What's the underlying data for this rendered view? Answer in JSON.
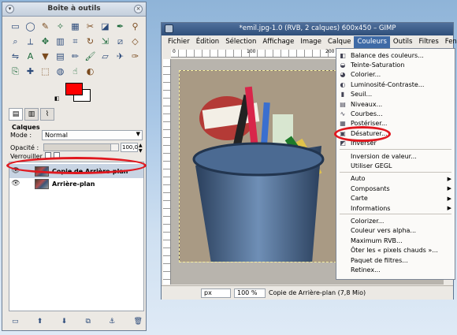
{
  "toolbox": {
    "title": "Boîte à outils",
    "tool_icons": [
      "rect-select",
      "ellipse-select",
      "free-select",
      "fuzzy-select",
      "color-select",
      "scissors-select",
      "foreground-select",
      "paths",
      "color-picker",
      "zoom",
      "measure",
      "move",
      "align",
      "crop",
      "rotate",
      "scale",
      "shear",
      "perspective",
      "flip",
      "text",
      "bucket-fill",
      "gradient",
      "pencil",
      "paintbrush",
      "eraser",
      "airbrush",
      "ink",
      "clone",
      "heal",
      "perspective-clone",
      "blur",
      "smudge",
      "dodge-burn"
    ],
    "colors": {
      "foreground": "#ff0000",
      "background": "#ffffff"
    },
    "layers_panel": {
      "title": "Calques",
      "mode_label": "Mode :",
      "mode_value": "Normal",
      "opacity_label": "Opacité :",
      "opacity_value": "100,0",
      "lock_label": "Verrouiller :",
      "layers": [
        {
          "name": "Copie de Arrière-plan",
          "visible": true,
          "selected": true
        },
        {
          "name": "Arrière-plan",
          "visible": true,
          "selected": false
        }
      ]
    }
  },
  "image_window": {
    "title": "*emil.jpg-1.0 (RVB, 2 calques) 600x450 – GIMP",
    "menus": [
      "Fichier",
      "Édition",
      "Sélection",
      "Affichage",
      "Image",
      "Calque",
      "Couleurs",
      "Outils",
      "Filtres",
      "Fenêtre"
    ],
    "open_menu": "Couleurs",
    "ruler_labels": [
      "0",
      "100",
      "200"
    ],
    "status": {
      "unit": "px",
      "zoom": "100 %",
      "text": "Copie de Arrière-plan (7,8 Mio)"
    }
  },
  "couleurs_menu": {
    "items": [
      {
        "label": "Balance des couleurs...",
        "icon": "color-balance-icon"
      },
      {
        "label": "Teinte-Saturation",
        "icon": "hue-saturation-icon"
      },
      {
        "label": "Colorier...",
        "icon": "colorize-icon"
      },
      {
        "label": "Luminosité-Contraste...",
        "icon": "brightness-contrast-icon"
      },
      {
        "label": "Seuil...",
        "icon": "threshold-icon"
      },
      {
        "label": "Niveaux...",
        "icon": "levels-icon"
      },
      {
        "label": "Courbes...",
        "icon": "curves-icon"
      },
      {
        "label": "Postériser...",
        "icon": "posterize-icon"
      },
      {
        "label": "Désaturer...",
        "icon": "desaturate-icon"
      },
      {
        "label": "Inverser",
        "icon": "invert-icon"
      },
      {
        "label": "Inversion de valeur...",
        "icon": ""
      },
      {
        "label": "Utiliser GEGL",
        "icon": ""
      },
      {
        "label": "Auto",
        "icon": "",
        "submenu": true
      },
      {
        "label": "Composants",
        "icon": "",
        "submenu": true
      },
      {
        "label": "Carte",
        "icon": "",
        "submenu": true
      },
      {
        "label": "Informations",
        "icon": "",
        "submenu": true
      },
      {
        "label": "Colorizer...",
        "icon": ""
      },
      {
        "label": "Couleur vers alpha...",
        "icon": ""
      },
      {
        "label": "Maximum RVB...",
        "icon": ""
      },
      {
        "label": "Ôter les « pixels chauds »...",
        "icon": ""
      },
      {
        "label": "Paquet de filtres...",
        "icon": ""
      },
      {
        "label": "Retinex...",
        "icon": ""
      }
    ]
  },
  "accent": {
    "highlight_red": "#e0181f",
    "menu_selected": "#3e6aa6"
  }
}
